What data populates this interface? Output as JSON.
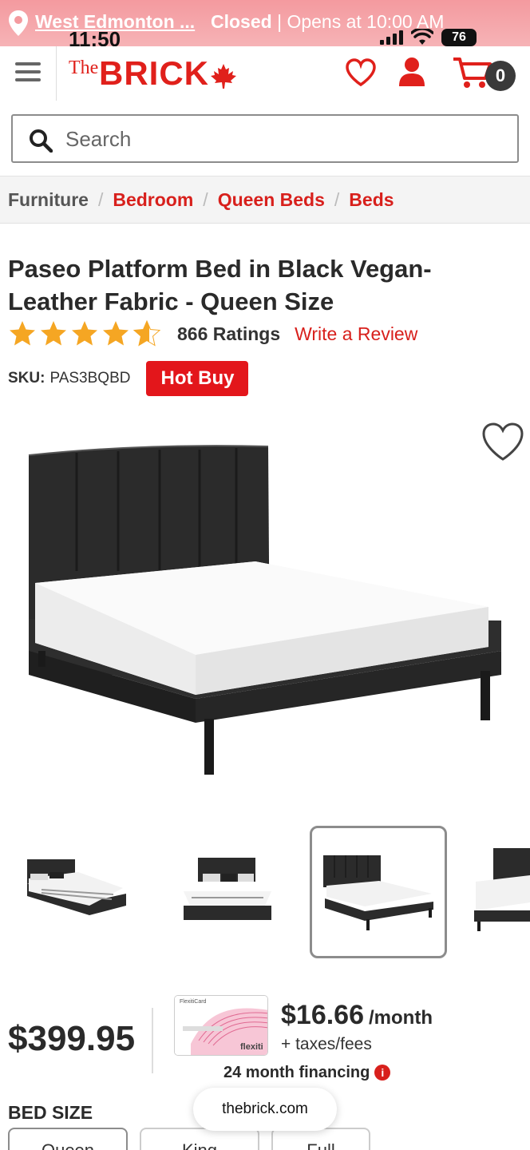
{
  "status_bar": {
    "store_name": "West Edmonton ...",
    "store_status": "Closed",
    "store_opens": "| Opens at 10:00 AM",
    "time": "11:50",
    "battery": "76"
  },
  "header": {
    "logo_the": "The",
    "logo_brick": "BRICK",
    "cart_count": "0"
  },
  "search": {
    "placeholder": "Search"
  },
  "breadcrumb": [
    {
      "label": "Furniture"
    },
    {
      "label": "Bedroom"
    },
    {
      "label": "Queen Beds"
    },
    {
      "label": "Beds"
    }
  ],
  "product": {
    "title": "Paseo Platform Bed in Black Vegan-Leather Fabric - Queen Size",
    "rating": 4.6,
    "rating_count": "866 Ratings",
    "write_review": "Write a Review",
    "sku_label": "SKU:",
    "sku_value": "PAS3BQBD",
    "badge": "Hot Buy"
  },
  "pricing": {
    "price": "$399.95",
    "monthly_amount": "$16.66",
    "monthly_period": "/month",
    "taxes": "+ taxes/fees",
    "financing_term": "24 month financing",
    "card_brand": "flexiti",
    "card_name": "FlexitiCard"
  },
  "bed_size": {
    "label": "BED SIZE",
    "options": [
      "Queen",
      "King",
      "Full"
    ]
  },
  "browser": {
    "url": "thebrick.com"
  },
  "colors": {
    "brand_red": "#e0201b",
    "star": "#f5a623"
  }
}
